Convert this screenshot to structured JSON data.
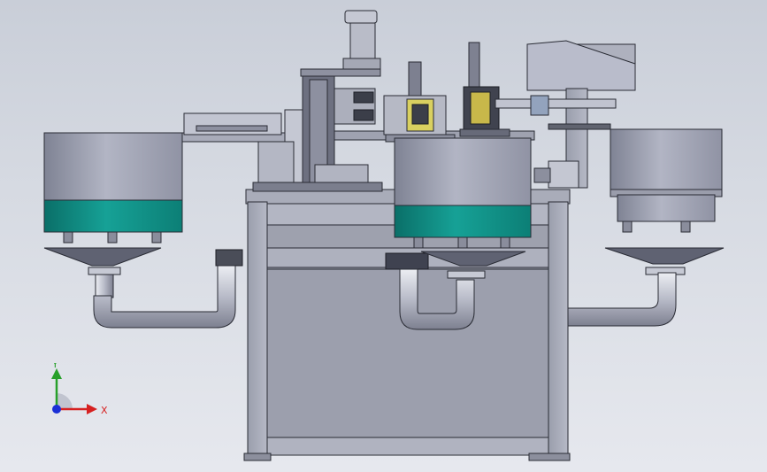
{
  "viewport": {
    "background_top": "#c9ced8",
    "background_bottom": "#e6e8ee"
  },
  "triad": {
    "x_label": "X",
    "y_label": "Y",
    "x_color": "#d62020",
    "y_color": "#27a02a",
    "z_color": "#1b2fd6"
  },
  "colors": {
    "steel": "#8f93a2",
    "steel_light": "#b4b7c4",
    "steel_dark": "#5d6070",
    "teal": "#0f8a80",
    "pipe": "#c3c6d1"
  }
}
